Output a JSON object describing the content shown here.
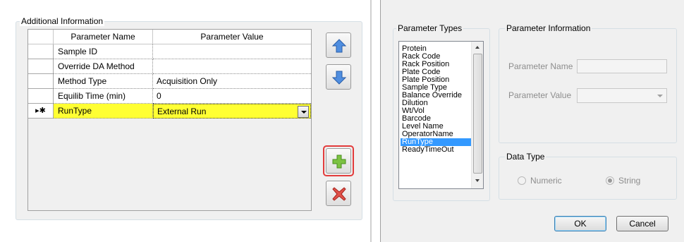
{
  "additional_info": {
    "group_title": "Additional Information",
    "columns": [
      "Parameter Name",
      "Parameter Value"
    ],
    "rows": [
      {
        "name": "Sample ID",
        "value": "",
        "marker": ""
      },
      {
        "name": "Override DA Method",
        "value": "",
        "marker": ""
      },
      {
        "name": "Method Type",
        "value": "Acquisition Only",
        "marker": ""
      },
      {
        "name": "Equilib Time (min)",
        "value": "0",
        "marker": ""
      },
      {
        "name": "RunType",
        "value": "External Run",
        "marker": "▸✱"
      }
    ],
    "buttons": {
      "move_up": "arrow-up-icon",
      "move_down": "arrow-down-icon",
      "add": "plus-icon",
      "remove": "red-x-icon"
    }
  },
  "dialog": {
    "parameter_types": {
      "title": "Parameter Types",
      "items": [
        "Protein",
        "Rack Code",
        "Rack Position",
        "Plate Code",
        "Plate Position",
        "Sample Type",
        "Balance Override",
        "Dilution",
        "Wt/Vol",
        "Barcode",
        "Level Name",
        "OperatorName",
        "RunType",
        "ReadyTimeOut"
      ],
      "selected": "RunType"
    },
    "parameter_information": {
      "title": "Parameter Information",
      "name_label": "Parameter Name",
      "name_value": "",
      "value_label": "Parameter Value",
      "value_value": ""
    },
    "data_type": {
      "title": "Data Type",
      "options": [
        "Numeric",
        "String"
      ],
      "selected": "String"
    },
    "ok_label": "OK",
    "cancel_label": "Cancel"
  },
  "colors": {
    "selected_row": "#ffff33",
    "list_selection": "#3399ff",
    "focus_highlight": "#e23b3b"
  }
}
